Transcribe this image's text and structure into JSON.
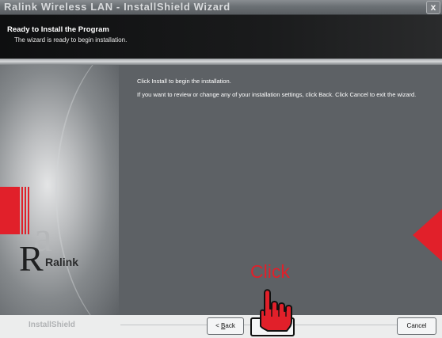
{
  "window": {
    "title": "Ralink Wireless LAN - InstallShield Wizard",
    "close_glyph": "x"
  },
  "header": {
    "title": "Ready to Install the Program",
    "subtitle": "The wizard is ready to begin installation."
  },
  "content": {
    "line1": "Click Install to begin the installation.",
    "line2": "If you want to review or change any of your installation settings, click Back. Click Cancel to exit the wizard."
  },
  "logo": {
    "letter_a": "a",
    "letter_R": "R",
    "wordmark": "Ralink"
  },
  "footer": {
    "brand": "InstallShield"
  },
  "buttons": {
    "back_prefix": "< ",
    "back_hotkey": "B",
    "back_rest": "ack",
    "install_hotkey": "I",
    "install_rest": "nstall",
    "cancel": "Cancel"
  },
  "annotation": {
    "callout": "Click"
  },
  "colors": {
    "highlight": "#e1202a"
  },
  "icons": {
    "pointer": "pointing-hand-icon"
  }
}
